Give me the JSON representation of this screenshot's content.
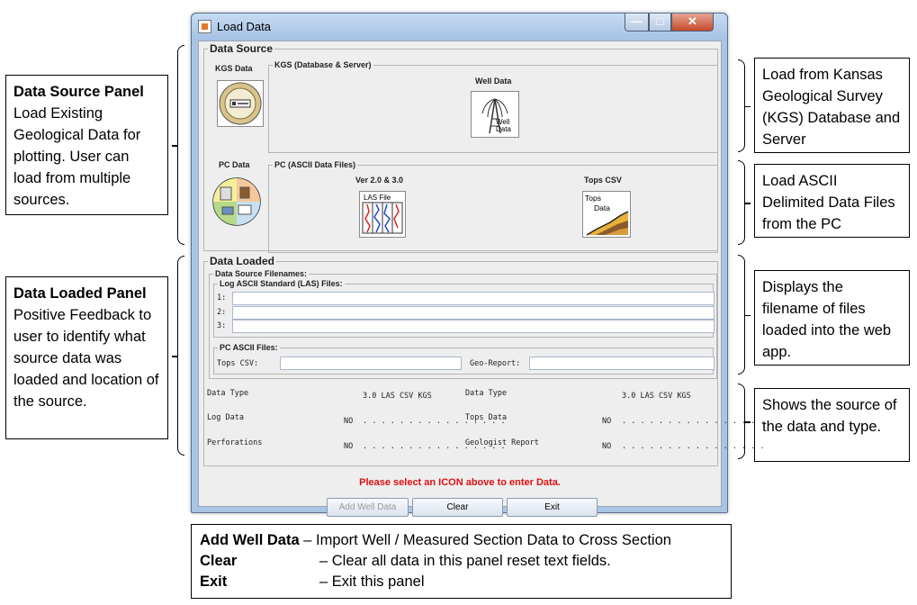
{
  "window": {
    "title": "Load Data",
    "min_glyph": "—",
    "max_glyph": "□",
    "close_glyph": "✕"
  },
  "data_source": {
    "legend": "Data Source",
    "kgs_label": "KGS Data",
    "kgs_group": "KGS (Database & Server)",
    "well_data_title": "Well Data",
    "well_icon_text_1": "Well",
    "well_icon_text_2": "Data",
    "pc_label": "PC Data",
    "pc_group": "PC (ASCII Data Files)",
    "las_version": "Ver 2.0 & 3.0",
    "las_icon_text": "LAS File",
    "tops_title": "Tops CSV",
    "tops_icon_text_1": "Tops",
    "tops_icon_text_2": "Data"
  },
  "data_loaded": {
    "legend": "Data Loaded",
    "filenames_legend": "Data Source Filenames:",
    "las_legend": "Log ASCII Standard (LAS) Files:",
    "row_labels": [
      "1:",
      "2:",
      "3:"
    ],
    "pc_legend": "PC ASCII Files:",
    "tops_csv_label": "Tops CSV:",
    "georeport_label": "Geo-Report:",
    "summary": {
      "left": {
        "header": "Data Type",
        "cols": "3.0  LAS  CSV  KGS",
        "rows": [
          {
            "name": "Log Data",
            "value": "NO",
            "dots": ". . . .  . . . .  . . . .  . . . ."
          },
          {
            "name": "Perforations",
            "value": "NO",
            "dots": ". . . .  . . . .  . . . .  . . . ."
          }
        ]
      },
      "right": {
        "header": "Data Type",
        "cols": "3.0  LAS  CSV  KGS",
        "rows": [
          {
            "name": "Tops Data",
            "value": "NO",
            "dots": ". . . .  . . . .  . . . .  . . . ."
          },
          {
            "name": "Geologist Report",
            "value": "NO",
            "dots": ". . . .  . . . .  . . . .  . . . ."
          }
        ]
      }
    }
  },
  "status_message": "Please select an ICON above to enter Data.",
  "buttons": {
    "add_well": "Add Well Data",
    "clear": "Clear",
    "exit": "Exit"
  },
  "callouts": {
    "source_panel": {
      "title": "Data Source Panel",
      "body": "Load Existing Geological Data for plotting. User can load from multiple sources."
    },
    "loaded_panel": {
      "title": "Data Loaded Panel",
      "body": "Positive Feedback to user to identify what source data was loaded and location of the source."
    },
    "kgs": "Load from Kansas Geological Survey (KGS) Database and Server",
    "ascii": "Load ASCII Delimited Data Files from the PC",
    "filenames": "Displays the filename of files loaded into the web app.",
    "source_type": "Shows the source of the data and type."
  },
  "legend_box": {
    "add_term": "Add Well Data",
    "add_desc": " – Import Well / Measured Section Data to Cross Section",
    "clear_term": "Clear",
    "clear_desc": "– Clear all data in this panel reset  text fields.",
    "exit_term": "Exit",
    "exit_desc": "– Exit this panel"
  },
  "colors": {
    "window_frame": "#a9c5e4",
    "status_red": "#e01010",
    "panel_bg": "#eeeeee"
  }
}
